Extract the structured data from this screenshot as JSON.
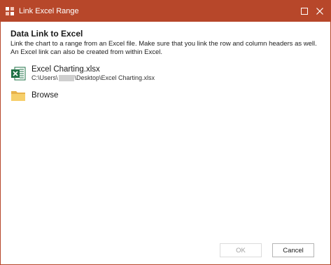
{
  "window": {
    "title": "Link Excel Range",
    "colors": {
      "titlebar": "#b7472a",
      "excel": "#1e7145",
      "folder": "#e8b24a"
    },
    "controls": {
      "maximize_icon": "maximize-icon",
      "close_icon": "close-icon"
    }
  },
  "main": {
    "heading": "Data Link to Excel",
    "description": "Link the chart to a range from an Excel file. Make sure that you link the row and column headers as well. An Excel link can also be created from within Excel.",
    "recent_file": {
      "name": "Excel Charting.xlsx",
      "path_prefix": "C:\\Users\\",
      "path_suffix": "\\Desktop\\Excel Charting.xlsx",
      "icon": "excel-file-icon"
    },
    "browse": {
      "label": "Browse",
      "icon": "folder-icon"
    }
  },
  "footer": {
    "ok_label": "OK",
    "cancel_label": "Cancel"
  }
}
